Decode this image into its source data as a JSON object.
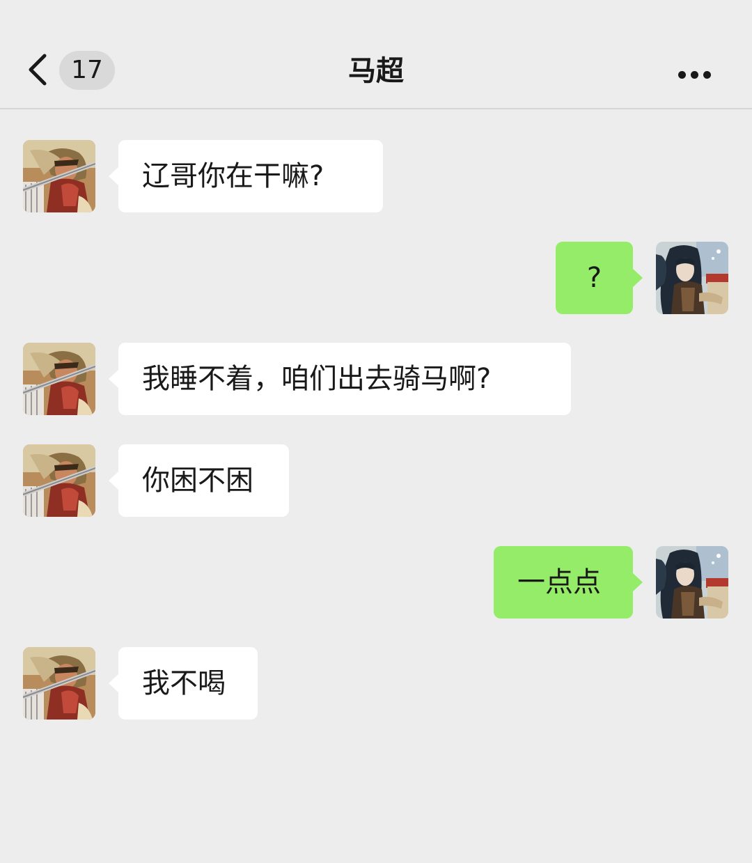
{
  "header": {
    "back_icon": "chevron-left-icon",
    "unread_count": "17",
    "title": "马超",
    "more_icon": "ellipsis-icon"
  },
  "messages": [
    {
      "sender": "马超",
      "direction": "incoming",
      "text": "辽哥你在干嘛?"
    },
    {
      "sender": "me",
      "direction": "outgoing",
      "text": "?"
    },
    {
      "sender": "马超",
      "direction": "incoming",
      "text": "我睡不着，咱们出去骑马啊?"
    },
    {
      "sender": "马超",
      "direction": "incoming",
      "text": "你困不困"
    },
    {
      "sender": "me",
      "direction": "outgoing",
      "text": "一点点"
    },
    {
      "sender": "马超",
      "direction": "incoming",
      "text": "我不喝"
    }
  ],
  "colors": {
    "background": "#ededed",
    "incoming_bubble": "#ffffff",
    "outgoing_bubble": "#95ec69",
    "text": "#191919"
  }
}
